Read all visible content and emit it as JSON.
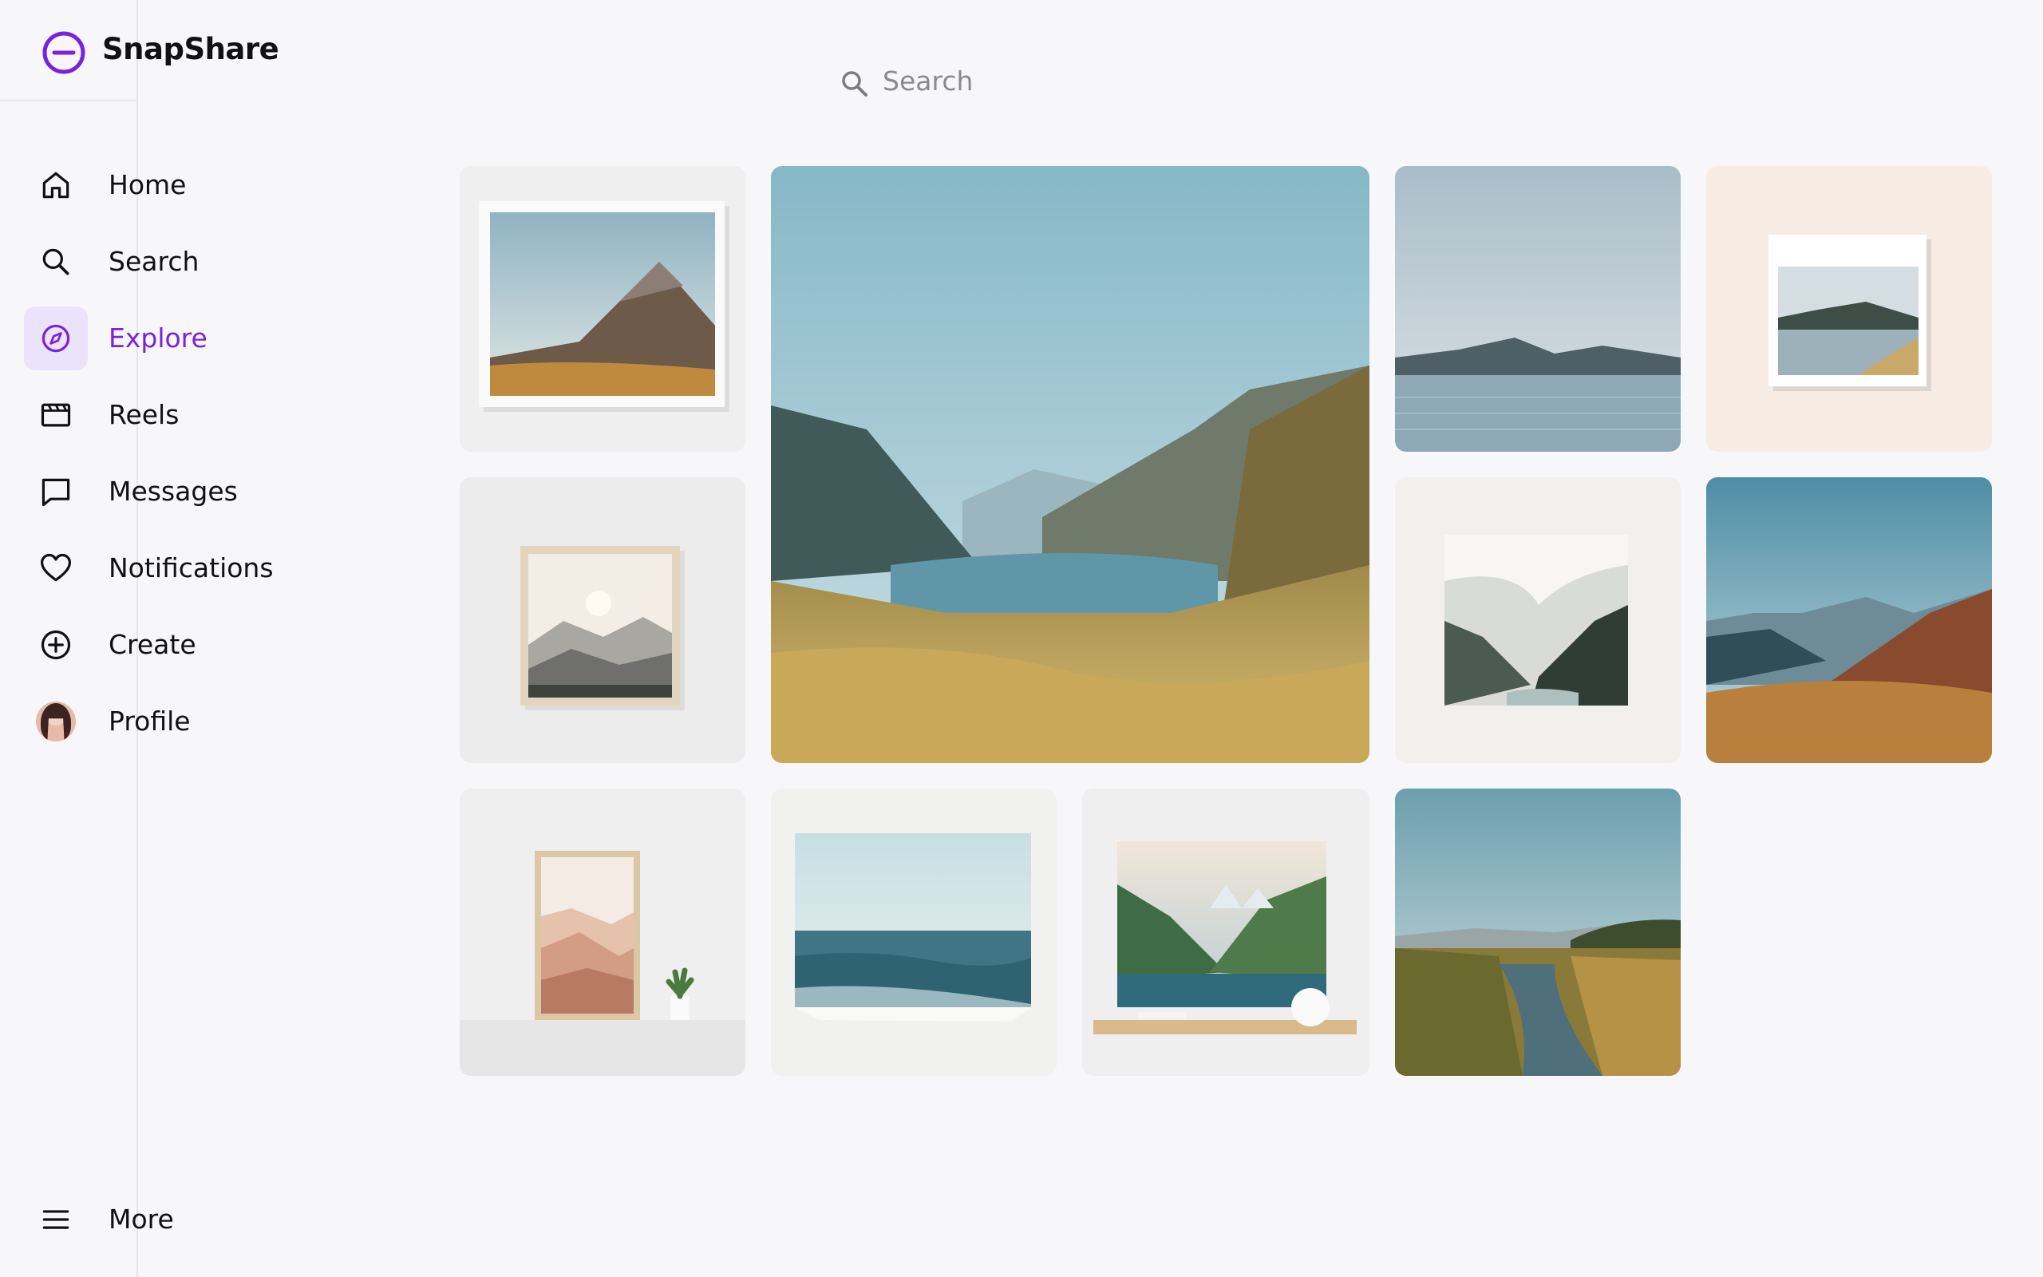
{
  "app": {
    "name": "SnapShare"
  },
  "nav": [
    {
      "key": "home",
      "label": "Home"
    },
    {
      "key": "search",
      "label": "Search"
    },
    {
      "key": "explore",
      "label": "Explore",
      "active": true
    },
    {
      "key": "reels",
      "label": "Reels"
    },
    {
      "key": "messages",
      "label": "Messages"
    },
    {
      "key": "notifications",
      "label": "Notifications"
    },
    {
      "key": "create",
      "label": "Create"
    },
    {
      "key": "profile",
      "label": "Profile"
    }
  ],
  "more": {
    "label": "More"
  },
  "search": {
    "placeholder": "Search"
  },
  "colors": {
    "accent": "#7a22dd",
    "active_bg": "#ebe3fb",
    "background": "#f7f7f9"
  },
  "icons": [
    "snapshare-logo-icon",
    "home-icon",
    "search-icon",
    "compass-icon",
    "reels-icon",
    "message-icon",
    "heart-icon",
    "plus-circle-icon",
    "avatar",
    "menu-icon"
  ],
  "explore_grid": [
    {
      "subject": "framed mountain print"
    },
    {
      "subject": "alpine lake valley"
    },
    {
      "subject": "lake with mountains"
    },
    {
      "subject": "small lakeside print"
    },
    {
      "subject": "minimal sunset mountains frame"
    },
    {
      "subject": "misty fjord print"
    },
    {
      "subject": "mountain ridges at golden hour"
    },
    {
      "subject": "terracotta hills frame with cactus"
    },
    {
      "subject": "ocean horizon print"
    },
    {
      "subject": "mountain lake canvas on shelf"
    },
    {
      "subject": "river through grassland"
    }
  ]
}
